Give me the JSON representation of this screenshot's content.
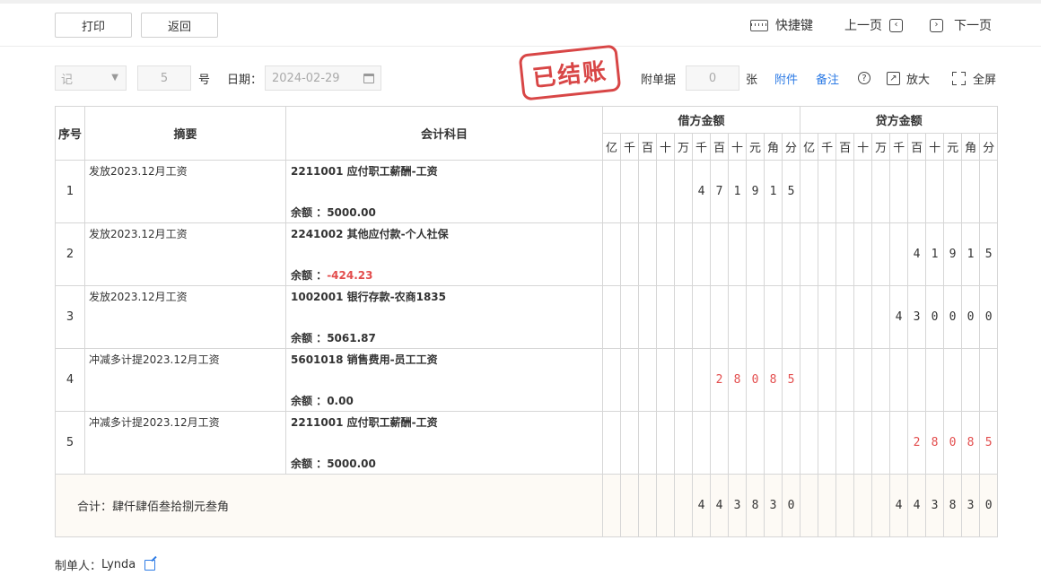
{
  "toolbar": {
    "print_label": "打印",
    "back_label": "返回",
    "shortcut_label": "快捷键",
    "prev_label": "上一页",
    "next_label": "下一页"
  },
  "filters": {
    "type_value": "记",
    "voucher_no": "5",
    "no_suffix": "号",
    "date_label": "日期：",
    "date_value": "2024-02-29",
    "stamp_text": "已结账",
    "attach_label": "附单据",
    "attach_count": "0",
    "attach_unit": "张",
    "attachment_link": "附件",
    "note_link": "备注",
    "zoom_label": "放大",
    "fullscreen_label": "全屏"
  },
  "table": {
    "headers": {
      "seq": "序号",
      "summary": "摘要",
      "account": "会计科目",
      "debit": "借方金额",
      "credit": "贷方金额",
      "digits": [
        "亿",
        "千",
        "百",
        "十",
        "万",
        "千",
        "百",
        "十",
        "元",
        "角",
        "分"
      ]
    },
    "balance_label": "余额 ：",
    "rows": [
      {
        "seq": "1",
        "summary": "发放2023.12月工资",
        "account": "2211001 应付职工薪酬-工资",
        "balance": "5000.00",
        "balance_negative": false,
        "debit": [
          "",
          "",
          "",
          "",
          "",
          "4",
          "7",
          "1",
          "9",
          "1",
          "5"
        ],
        "debit_red": false,
        "credit": [
          "",
          "",
          "",
          "",
          "",
          "",
          "",
          "",
          "",
          "",
          ""
        ],
        "credit_red": false
      },
      {
        "seq": "2",
        "summary": "发放2023.12月工资",
        "account": "2241002 其他应付款-个人社保",
        "balance": "-424.23",
        "balance_negative": true,
        "debit": [
          "",
          "",
          "",
          "",
          "",
          "",
          "",
          "",
          "",
          "",
          ""
        ],
        "debit_red": false,
        "credit": [
          "",
          "",
          "",
          "",
          "",
          "",
          "4",
          "1",
          "9",
          "1",
          "5"
        ],
        "credit_red": false
      },
      {
        "seq": "3",
        "summary": "发放2023.12月工资",
        "account": "1002001 银行存款-农商1835",
        "balance": "5061.87",
        "balance_negative": false,
        "debit": [
          "",
          "",
          "",
          "",
          "",
          "",
          "",
          "",
          "",
          "",
          ""
        ],
        "debit_red": false,
        "credit": [
          "",
          "",
          "",
          "",
          "",
          "4",
          "3",
          "0",
          "0",
          "0",
          "0"
        ],
        "credit_red": false
      },
      {
        "seq": "4",
        "summary": "冲减多计提2023.12月工资",
        "account": "5601018 销售费用-员工工资",
        "balance": "0.00",
        "balance_negative": false,
        "debit": [
          "",
          "",
          "",
          "",
          "",
          "",
          "2",
          "8",
          "0",
          "8",
          "5"
        ],
        "debit_red": true,
        "credit": [
          "",
          "",
          "",
          "",
          "",
          "",
          "",
          "",
          "",
          "",
          ""
        ],
        "credit_red": false
      },
      {
        "seq": "5",
        "summary": "冲减多计提2023.12月工资",
        "account": "2211001 应付职工薪酬-工资",
        "balance": "5000.00",
        "balance_negative": false,
        "debit": [
          "",
          "",
          "",
          "",
          "",
          "",
          "",
          "",
          "",
          "",
          ""
        ],
        "debit_red": false,
        "credit": [
          "",
          "",
          "",
          "",
          "",
          "",
          "2",
          "8",
          "0",
          "8",
          "5"
        ],
        "credit_red": true
      }
    ],
    "total": {
      "label": "合计：肆仟肆佰叁拾捌元叁角",
      "debit": [
        "",
        "",
        "",
        "",
        "",
        "4",
        "4",
        "3",
        "8",
        "3",
        "0"
      ],
      "credit": [
        "",
        "",
        "",
        "",
        "",
        "4",
        "4",
        "3",
        "8",
        "3",
        "0"
      ]
    }
  },
  "footer": {
    "maker_label": "制单人：",
    "maker_name": "Lynda"
  },
  "colors": {
    "accent": "#2d7be5",
    "negative": "#e34d4d",
    "stamp": "#d43333"
  }
}
